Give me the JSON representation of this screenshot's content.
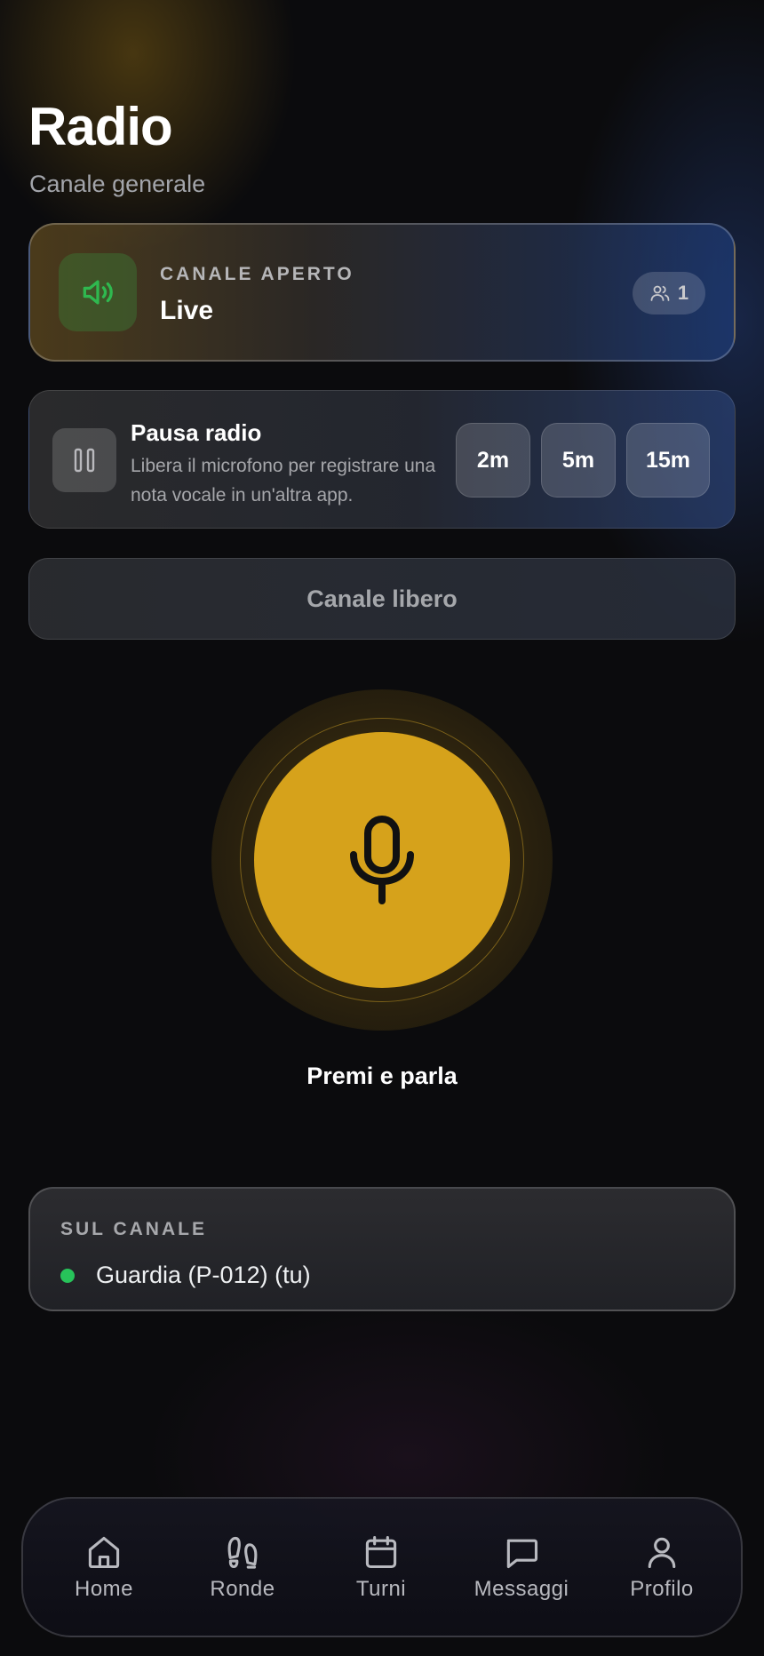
{
  "header": {
    "title": "Radio",
    "subtitle": "Canale generale"
  },
  "channel": {
    "label": "CANALE APERTO",
    "status": "Live",
    "member_count": "1",
    "icon": "speaker-icon",
    "status_color": "#2fb84f"
  },
  "pause": {
    "title": "Pausa radio",
    "description": "Libera il microfono per registrare una nota vocale in un'altra app.",
    "durations": [
      "2m",
      "5m",
      "15m"
    ]
  },
  "channel_state": {
    "label": "Canale libero"
  },
  "ptt": {
    "caption": "Premi e parla",
    "color": "#d6a21b",
    "icon": "microphone-icon"
  },
  "on_channel": {
    "label": "SUL CANALE",
    "members": [
      {
        "name": "Guardia (P-012) (tu)",
        "online_color": "#27c35a"
      }
    ]
  },
  "nav": {
    "items": [
      {
        "label": "Home",
        "icon": "home-icon"
      },
      {
        "label": "Ronde",
        "icon": "footprints-icon"
      },
      {
        "label": "Turni",
        "icon": "calendar-icon"
      },
      {
        "label": "Messaggi",
        "icon": "message-icon"
      },
      {
        "label": "Profilo",
        "icon": "user-icon"
      }
    ]
  }
}
